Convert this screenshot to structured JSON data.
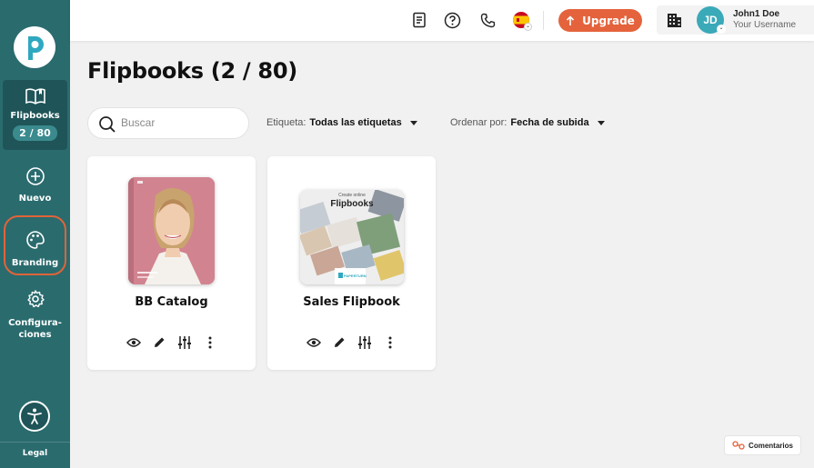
{
  "sidebar": {
    "items": [
      {
        "label": "Flipbooks",
        "badge": "2 / 80"
      },
      {
        "label": "Nuevo"
      },
      {
        "label": "Branding"
      },
      {
        "label_line1": "Configura-",
        "label_line2": "ciones"
      }
    ],
    "legal": "Legal"
  },
  "topbar": {
    "upgrade_label": "Upgrade",
    "user_initials": "JD",
    "user_name": "John1 Doe",
    "user_subtitle": "Your Username"
  },
  "main": {
    "title": "Flipbooks (2 / 80)",
    "search_placeholder": "Buscar",
    "filter_tag_label": "Etiqueta:",
    "filter_tag_value": "Todas las etiquetas",
    "sort_label": "Ordenar por:",
    "sort_value": "Fecha de subida"
  },
  "flipbooks": [
    {
      "title": "BB Catalog"
    },
    {
      "title": "Sales Flipbook",
      "cover_heading": "Flipbooks",
      "cover_top": "Create online",
      "cover_brand": "PAPERTURN"
    }
  ],
  "comments_label": "Comentarios",
  "colors": {
    "sidebar": "#2a6b6e",
    "accent": "#e4633c",
    "avatar": "#3aa9b8"
  }
}
